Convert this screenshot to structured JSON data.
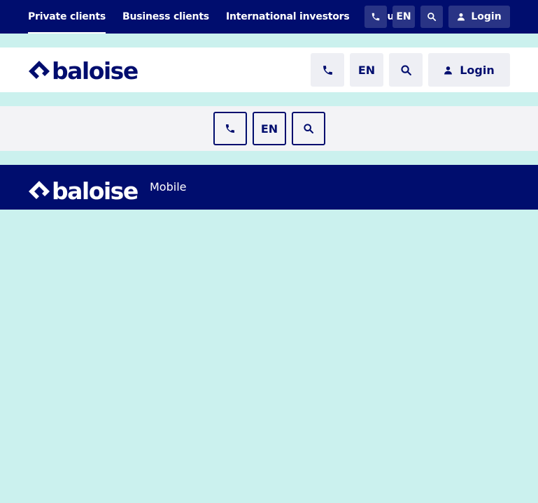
{
  "topnav": {
    "links": [
      {
        "label": "Private clients",
        "active": true
      },
      {
        "label": "Business clients",
        "active": false
      },
      {
        "label": "International investors",
        "active": false
      },
      {
        "label": "About",
        "active": false
      }
    ],
    "lang_label": "EN",
    "login_label": "Login"
  },
  "header": {
    "logo_text": "baloise",
    "lang_label": "EN",
    "login_label": "Login"
  },
  "subbar": {
    "lang_label": "EN"
  },
  "mobilebar": {
    "logo_text": "baloise",
    "subtitle": "Mobile"
  },
  "colors": {
    "navy": "#000d6e",
    "mint_background": "#cbf1ee",
    "header_button_bg": "#eeeff4",
    "subbar_bg": "#f3f3f6"
  },
  "icons": [
    "phone-icon",
    "search-icon",
    "user-icon",
    "baloise-logo-mark"
  ]
}
